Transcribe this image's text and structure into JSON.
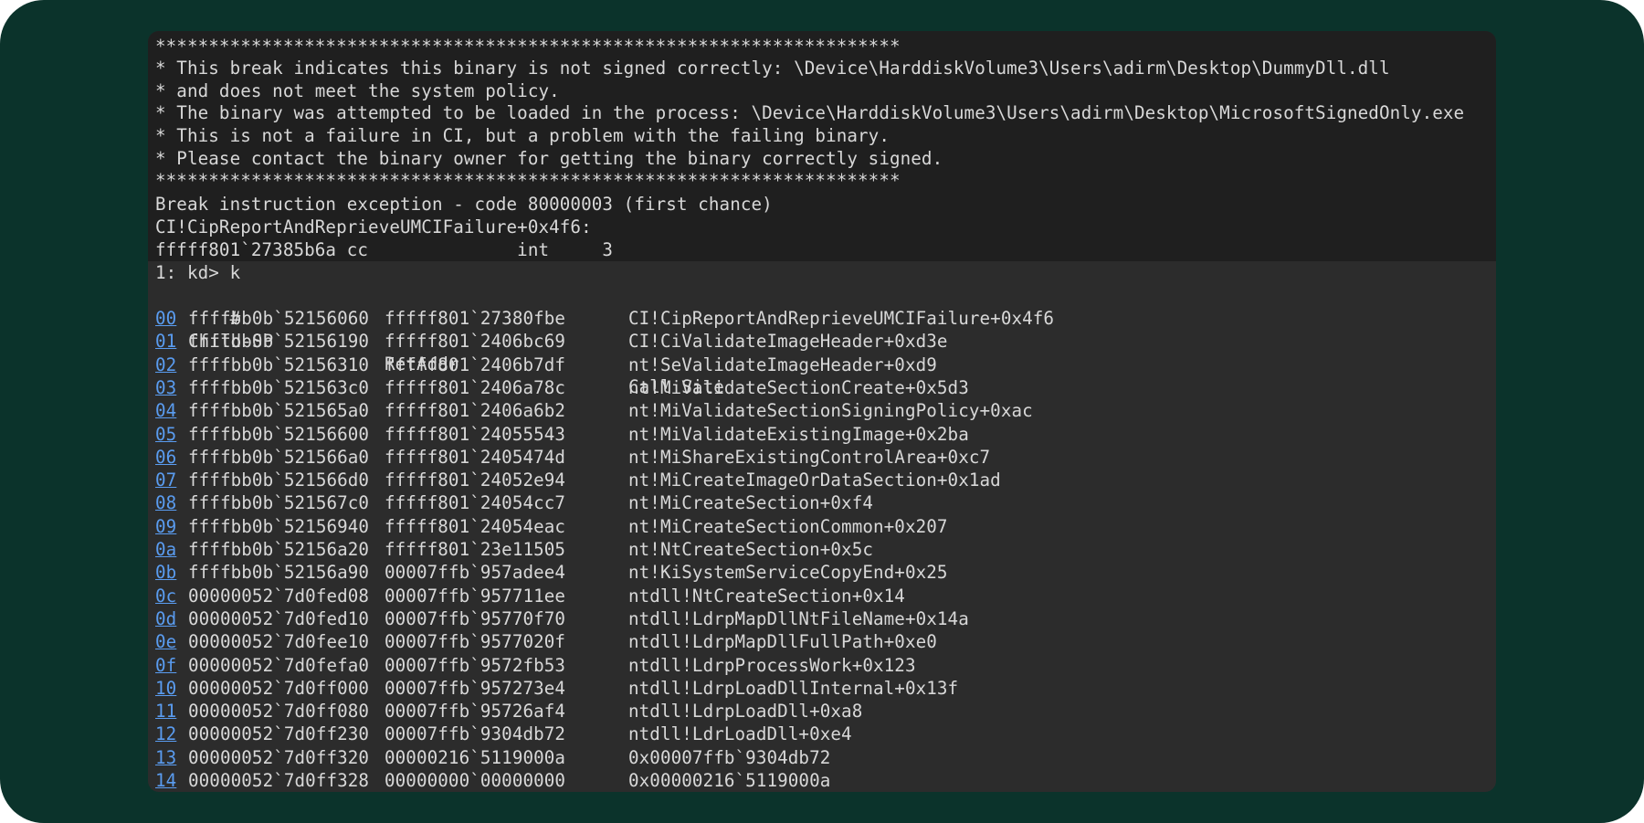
{
  "banner": {
    "stars_top": "**********************************************************************",
    "lines": [
      "* This break indicates this binary is not signed correctly: \\Device\\HarddiskVolume3\\Users\\adirm\\Desktop\\DummyDll.dll",
      "* and does not meet the system policy.",
      "* The binary was attempted to be loaded in the process: \\Device\\HarddiskVolume3\\Users\\adirm\\Desktop\\MicrosoftSignedOnly.exe",
      "* This is not a failure in CI, but a problem with the failing binary.",
      "* Please contact the binary owner for getting the binary correctly signed."
    ],
    "stars_bottom": "**********************************************************************"
  },
  "exception": {
    "line1": "Break instruction exception - code 80000003 (first chance)",
    "line2": "CI!CipReportAndReprieveUMCIFailure+0x4f6:",
    "line3": "fffff801`27385b6a cc              int     3"
  },
  "prompt": "1: kd> k",
  "stack": {
    "headers": {
      "num": " #",
      "child_sp": "Child-SP",
      "ret_addr": "RetAddr",
      "call_site": "Call Site"
    },
    "rows": [
      {
        "num": "00",
        "child_sp": "ffffbb0b`52156060",
        "ret_addr": "fffff801`27380fbe",
        "call_site": "CI!CipReportAndReprieveUMCIFailure+0x4f6"
      },
      {
        "num": "01",
        "child_sp": "ffffbb0b`52156190",
        "ret_addr": "fffff801`2406bc69",
        "call_site": "CI!CiValidateImageHeader+0xd3e"
      },
      {
        "num": "02",
        "child_sp": "ffffbb0b`52156310",
        "ret_addr": "fffff801`2406b7df",
        "call_site": "nt!SeValidateImageHeader+0xd9"
      },
      {
        "num": "03",
        "child_sp": "ffffbb0b`521563c0",
        "ret_addr": "fffff801`2406a78c",
        "call_site": "nt!MiValidateSectionCreate+0x5d3"
      },
      {
        "num": "04",
        "child_sp": "ffffbb0b`521565a0",
        "ret_addr": "fffff801`2406a6b2",
        "call_site": "nt!MiValidateSectionSigningPolicy+0xac"
      },
      {
        "num": "05",
        "child_sp": "ffffbb0b`52156600",
        "ret_addr": "fffff801`24055543",
        "call_site": "nt!MiValidateExistingImage+0x2ba"
      },
      {
        "num": "06",
        "child_sp": "ffffbb0b`521566a0",
        "ret_addr": "fffff801`2405474d",
        "call_site": "nt!MiShareExistingControlArea+0xc7"
      },
      {
        "num": "07",
        "child_sp": "ffffbb0b`521566d0",
        "ret_addr": "fffff801`24052e94",
        "call_site": "nt!MiCreateImageOrDataSection+0x1ad"
      },
      {
        "num": "08",
        "child_sp": "ffffbb0b`521567c0",
        "ret_addr": "fffff801`24054cc7",
        "call_site": "nt!MiCreateSection+0xf4"
      },
      {
        "num": "09",
        "child_sp": "ffffbb0b`52156940",
        "ret_addr": "fffff801`24054eac",
        "call_site": "nt!MiCreateSectionCommon+0x207"
      },
      {
        "num": "0a",
        "child_sp": "ffffbb0b`52156a20",
        "ret_addr": "fffff801`23e11505",
        "call_site": "nt!NtCreateSection+0x5c"
      },
      {
        "num": "0b",
        "child_sp": "ffffbb0b`52156a90",
        "ret_addr": "00007ffb`957adee4",
        "call_site": "nt!KiSystemServiceCopyEnd+0x25"
      },
      {
        "num": "0c",
        "child_sp": "00000052`7d0fed08",
        "ret_addr": "00007ffb`957711ee",
        "call_site": "ntdll!NtCreateSection+0x14"
      },
      {
        "num": "0d",
        "child_sp": "00000052`7d0fed10",
        "ret_addr": "00007ffb`95770f70",
        "call_site": "ntdll!LdrpMapDllNtFileName+0x14a"
      },
      {
        "num": "0e",
        "child_sp": "00000052`7d0fee10",
        "ret_addr": "00007ffb`9577020f",
        "call_site": "ntdll!LdrpMapDllFullPath+0xe0"
      },
      {
        "num": "0f",
        "child_sp": "00000052`7d0fefa0",
        "ret_addr": "00007ffb`9572fb53",
        "call_site": "ntdll!LdrpProcessWork+0x123"
      },
      {
        "num": "10",
        "child_sp": "00000052`7d0ff000",
        "ret_addr": "00007ffb`957273e4",
        "call_site": "ntdll!LdrpLoadDllInternal+0x13f"
      },
      {
        "num": "11",
        "child_sp": "00000052`7d0ff080",
        "ret_addr": "00007ffb`95726af4",
        "call_site": "ntdll!LdrpLoadDll+0xa8"
      },
      {
        "num": "12",
        "child_sp": "00000052`7d0ff230",
        "ret_addr": "00007ffb`9304db72",
        "call_site": "ntdll!LdrLoadDll+0xe4"
      },
      {
        "num": "13",
        "child_sp": "00000052`7d0ff320",
        "ret_addr": "00000216`5119000a",
        "call_site": "0x00007ffb`9304db72"
      },
      {
        "num": "14",
        "child_sp": "00000052`7d0ff328",
        "ret_addr": "00000000`00000000",
        "call_site": "0x00000216`5119000a"
      }
    ]
  },
  "colors": {
    "frame_bg": "#0b332b",
    "console_bg": "#2c2c2c",
    "banner_bg": "#1f1f1f",
    "text": "#d8d8d8",
    "link": "#5a9cf0"
  }
}
